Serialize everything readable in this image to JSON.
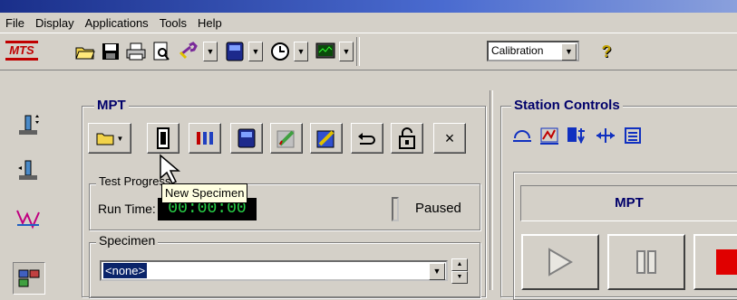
{
  "menu": [
    "File",
    "Display",
    "Applications",
    "Tools",
    "Help"
  ],
  "toolbar": {
    "calibration_value": "Calibration",
    "logo_text": "MTS",
    "buttons": [
      "open-folder-icon",
      "save-icon",
      "print-icon",
      "print-preview-icon",
      "wrench-icon",
      "station-icon",
      "clock-icon",
      "monitor-icon",
      "help-icon"
    ]
  },
  "mpt": {
    "title": "MPT",
    "toolbar_close": "×",
    "test_progress": {
      "label": "Test Progress",
      "run_time_label": "Run Time:",
      "run_time_value": "00:00:00",
      "status": "Paused"
    },
    "specimen": {
      "label": "Specimen",
      "value": "<none>"
    }
  },
  "station_controls": {
    "title": "Station Controls",
    "panel_label": "MPT"
  },
  "tooltip": "New Specimen",
  "colors": {
    "stop": "#e00000",
    "lcd_text": "#27d047",
    "selection": "#0a246a"
  }
}
